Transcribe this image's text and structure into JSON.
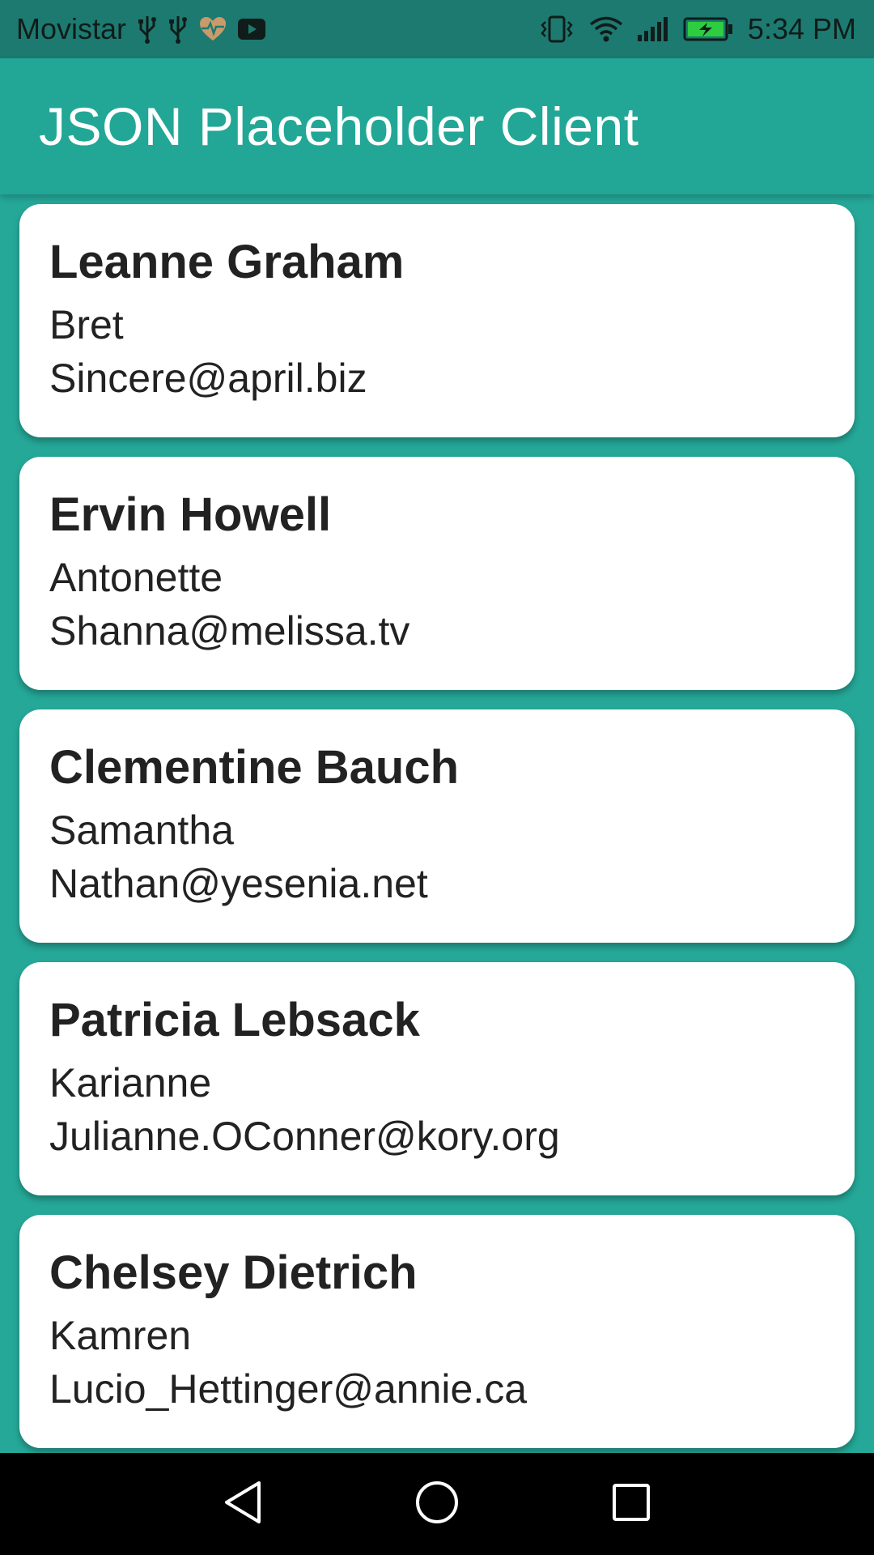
{
  "status_bar": {
    "carrier": "Movistar",
    "time": "5:34 PM",
    "left_icons": [
      "usb-icon",
      "usb-icon",
      "heart-rate-icon",
      "youtube-icon"
    ],
    "right_icons": [
      "vibrate-icon",
      "wifi-icon",
      "signal-icon",
      "battery-charging-icon"
    ],
    "battery_color": "#2ecc40"
  },
  "app_bar": {
    "title": "JSON Placeholder Client",
    "color": "#22a797"
  },
  "users": [
    {
      "name": "Leanne Graham",
      "username": "Bret",
      "email": "Sincere@april.biz"
    },
    {
      "name": "Ervin Howell",
      "username": "Antonette",
      "email": "Shanna@melissa.tv"
    },
    {
      "name": "Clementine Bauch",
      "username": "Samantha",
      "email": "Nathan@yesenia.net"
    },
    {
      "name": "Patricia Lebsack",
      "username": "Karianne",
      "email": "Julianne.OConner@kory.org"
    },
    {
      "name": "Chelsey Dietrich",
      "username": "Kamren",
      "email": "Lucio_Hettinger@annie.ca"
    }
  ],
  "nav_bar": {
    "buttons": [
      "back-icon",
      "home-icon",
      "recents-icon"
    ]
  },
  "colors": {
    "background": "#25a898",
    "status_bar": "#1d7a70",
    "card": "#ffffff",
    "text": "#222222"
  }
}
